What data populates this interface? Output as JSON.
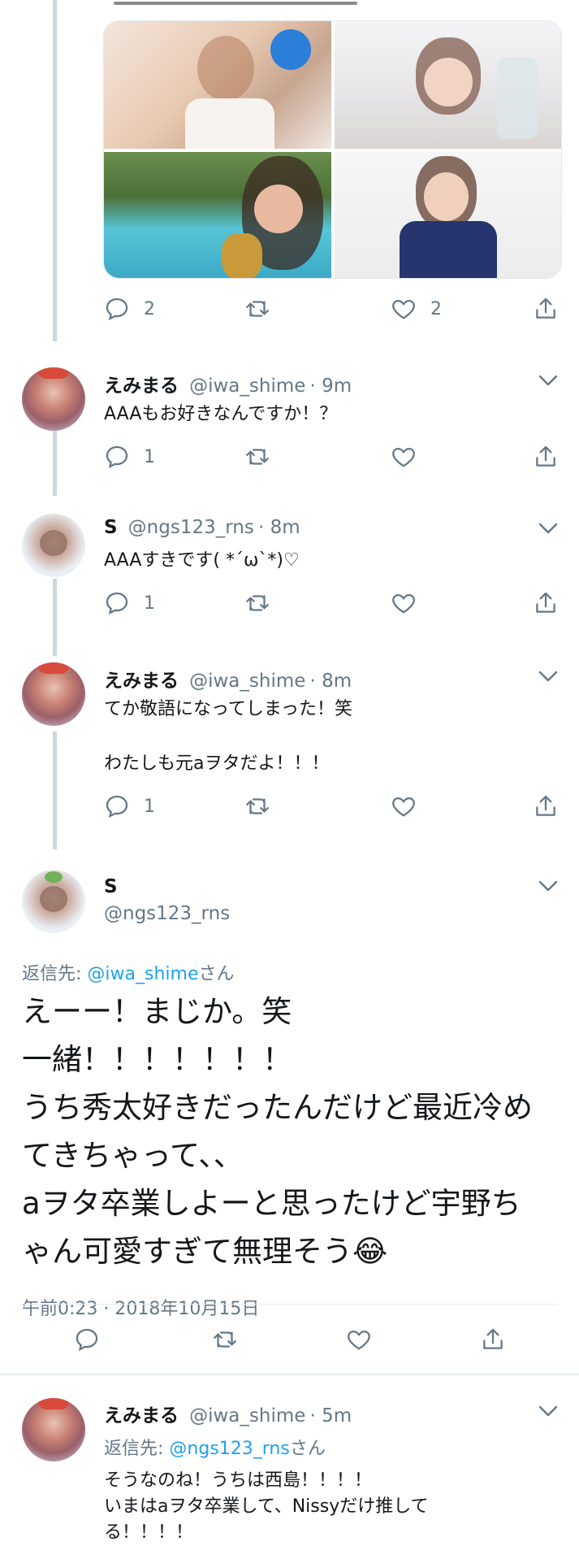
{
  "colors": {
    "link": "#1da1f2",
    "muted": "#657786",
    "divider": "#e6ecf0",
    "thread": "#ccd6dd"
  },
  "first_tweet": {
    "photos": [
      "photo-1",
      "photo-2",
      "photo-3",
      "photo-4"
    ],
    "actions": {
      "reply_count": "2",
      "like_count": "2"
    }
  },
  "replies": [
    {
      "name": "えみまる",
      "handle": "@iwa_shime",
      "time": "9m",
      "text_lines": [
        "AAAもお好きなんですか！？"
      ],
      "reply_count": "1"
    },
    {
      "name": "S",
      "handle": "@ngs123_rns",
      "time": "8m",
      "text_lines": [
        "AAAすきです( *´ω`*)♡"
      ],
      "reply_count": "1"
    },
    {
      "name": "えみまる",
      "handle": "@iwa_shime",
      "time": "8m",
      "text_lines": [
        "てか敬語になってしまった！笑",
        "わたしも元aヲタだよ！！！"
      ],
      "reply_count": "1"
    }
  ],
  "focused": {
    "name": "S",
    "handle": "@ngs123_rns",
    "reply_prefix": "返信先: ",
    "reply_to": "@iwa_shime",
    "reply_suffix": "さん",
    "text_lines": [
      "えーー！まじか。笑",
      "一緒！！！！！！！",
      "うち秀太好きだったんだけど最近冷め",
      "てきちゃって、、",
      "aヲタ卒業しよーと思ったけど宇野ち",
      "ゃん可愛すぎて無理そう😂"
    ],
    "timestamp": "午前0:23 · 2018年10月15日"
  },
  "last_reply": {
    "name": "えみまる",
    "handle": "@iwa_shime",
    "time": "5m",
    "reply_prefix": "返信先: ",
    "reply_to": "@ngs123_rns",
    "reply_suffix": "さん",
    "text_lines": [
      "そうなのね！うちは西島！！！！",
      "いまはaヲタ卒業して、Nissyだけ推して",
      "る！！！！"
    ]
  },
  "icons": [
    "reply-icon",
    "retweet-icon",
    "like-icon",
    "share-icon",
    "chevron-down-icon"
  ]
}
